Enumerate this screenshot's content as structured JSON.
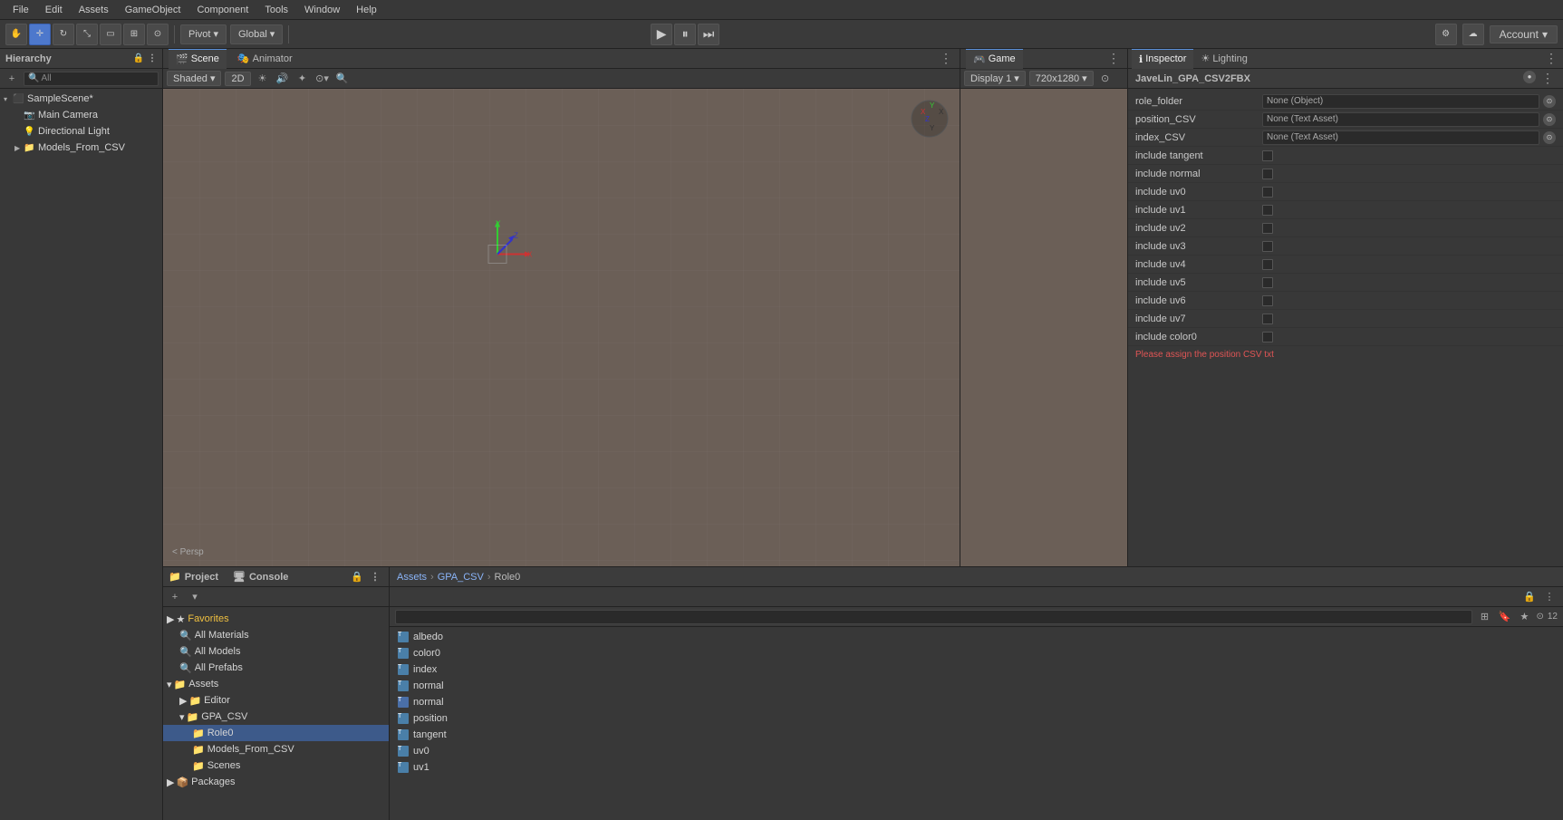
{
  "menu": {
    "items": [
      "File",
      "Edit",
      "Assets",
      "GameObject",
      "Component",
      "Tools",
      "Window",
      "Help"
    ]
  },
  "toolbar": {
    "transform_tools": [
      "hand",
      "move",
      "rotate",
      "scale",
      "rect",
      "universal"
    ],
    "pivot_label": "Pivot",
    "global_label": "Global",
    "play_button": "▶",
    "pause_button": "⏸",
    "step_button": "⏭",
    "account_label": "Account",
    "collab_icon": "☁"
  },
  "hierarchy": {
    "panel_title": "Hierarchy",
    "search_placeholder": "All",
    "items": [
      {
        "label": "SampleScene*",
        "type": "scene",
        "indent": 0,
        "expanded": true
      },
      {
        "label": "Main Camera",
        "type": "camera",
        "indent": 1
      },
      {
        "label": "Directional Light",
        "type": "light",
        "indent": 1
      },
      {
        "label": "Models_From_CSV",
        "type": "folder",
        "indent": 1
      }
    ]
  },
  "scene": {
    "tab_label": "Scene",
    "animator_tab": "Animator",
    "toolbar": {
      "shading_mode": "Shaded",
      "view_2d": "2D",
      "perspective_label": "< Persp"
    }
  },
  "game": {
    "tab_label": "Game",
    "display_label": "Display 1",
    "resolution_label": "720x1280"
  },
  "inspector": {
    "tab_label": "Inspector",
    "lighting_tab": "Lighting",
    "csv_title": "JaveLin_GPA_CSV2FBX",
    "fields": [
      {
        "label": "role_folder",
        "type": "object",
        "value": "None (Object)"
      },
      {
        "label": "position_CSV",
        "type": "object",
        "value": "None (Text Asset)"
      },
      {
        "label": "index_CSV",
        "type": "object",
        "value": "None (Text Asset)"
      },
      {
        "label": "include tangent",
        "type": "checkbox",
        "value": false
      },
      {
        "label": "include normal",
        "type": "checkbox",
        "value": false
      },
      {
        "label": "include uv0",
        "type": "checkbox",
        "value": false
      },
      {
        "label": "include uv1",
        "type": "checkbox",
        "value": false
      },
      {
        "label": "include uv2",
        "type": "checkbox",
        "value": false
      },
      {
        "label": "include uv3",
        "type": "checkbox",
        "value": false
      },
      {
        "label": "include uv4",
        "type": "checkbox",
        "value": false
      },
      {
        "label": "include uv5",
        "type": "checkbox",
        "value": false
      },
      {
        "label": "include uv6",
        "type": "checkbox",
        "value": false
      },
      {
        "label": "include uv7",
        "type": "checkbox",
        "value": false
      },
      {
        "label": "include color0",
        "type": "checkbox",
        "value": false
      }
    ],
    "error_text": "Please assign the position CSV txt"
  },
  "project": {
    "panel_title": "Project",
    "console_tab": "Console",
    "favorites": {
      "label": "Favorites",
      "items": [
        "All Materials",
        "All Models",
        "All Prefabs"
      ]
    },
    "assets": {
      "label": "Assets",
      "items": [
        {
          "label": "Editor",
          "type": "folder",
          "indent": 1
        },
        {
          "label": "GPA_CSV",
          "type": "folder",
          "indent": 1,
          "expanded": true
        },
        {
          "label": "Role0",
          "type": "folder",
          "indent": 2,
          "selected": true
        },
        {
          "label": "Models_From_CSV",
          "type": "folder",
          "indent": 2
        },
        {
          "label": "Scenes",
          "type": "folder",
          "indent": 2
        }
      ]
    },
    "packages": {
      "label": "Packages"
    }
  },
  "file_browser": {
    "breadcrumbs": [
      "Assets",
      "GPA_CSV",
      "Role0"
    ],
    "search_placeholder": "",
    "files": [
      {
        "name": "albedo",
        "type": "txt"
      },
      {
        "name": "color0",
        "type": "txt"
      },
      {
        "name": "index",
        "type": "txt"
      },
      {
        "name": "normal",
        "type": "txt"
      },
      {
        "name": "normal",
        "type": "txt_blue"
      },
      {
        "name": "position",
        "type": "txt"
      },
      {
        "name": "tangent",
        "type": "txt"
      },
      {
        "name": "uv0",
        "type": "txt"
      },
      {
        "name": "uv1",
        "type": "txt"
      }
    ],
    "count_label": "12"
  }
}
